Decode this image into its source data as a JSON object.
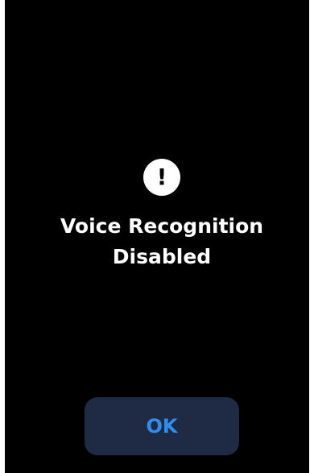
{
  "alert": {
    "icon": "exclamation-icon",
    "icon_glyph": "!",
    "title_line1": "Voice Recognition",
    "title_line2": "Disabled"
  },
  "actions": {
    "ok_label": "OK"
  },
  "colors": {
    "background": "#000000",
    "text": "#ffffff",
    "button_bg": "#1f2a44",
    "button_text": "#2f8ff0"
  }
}
